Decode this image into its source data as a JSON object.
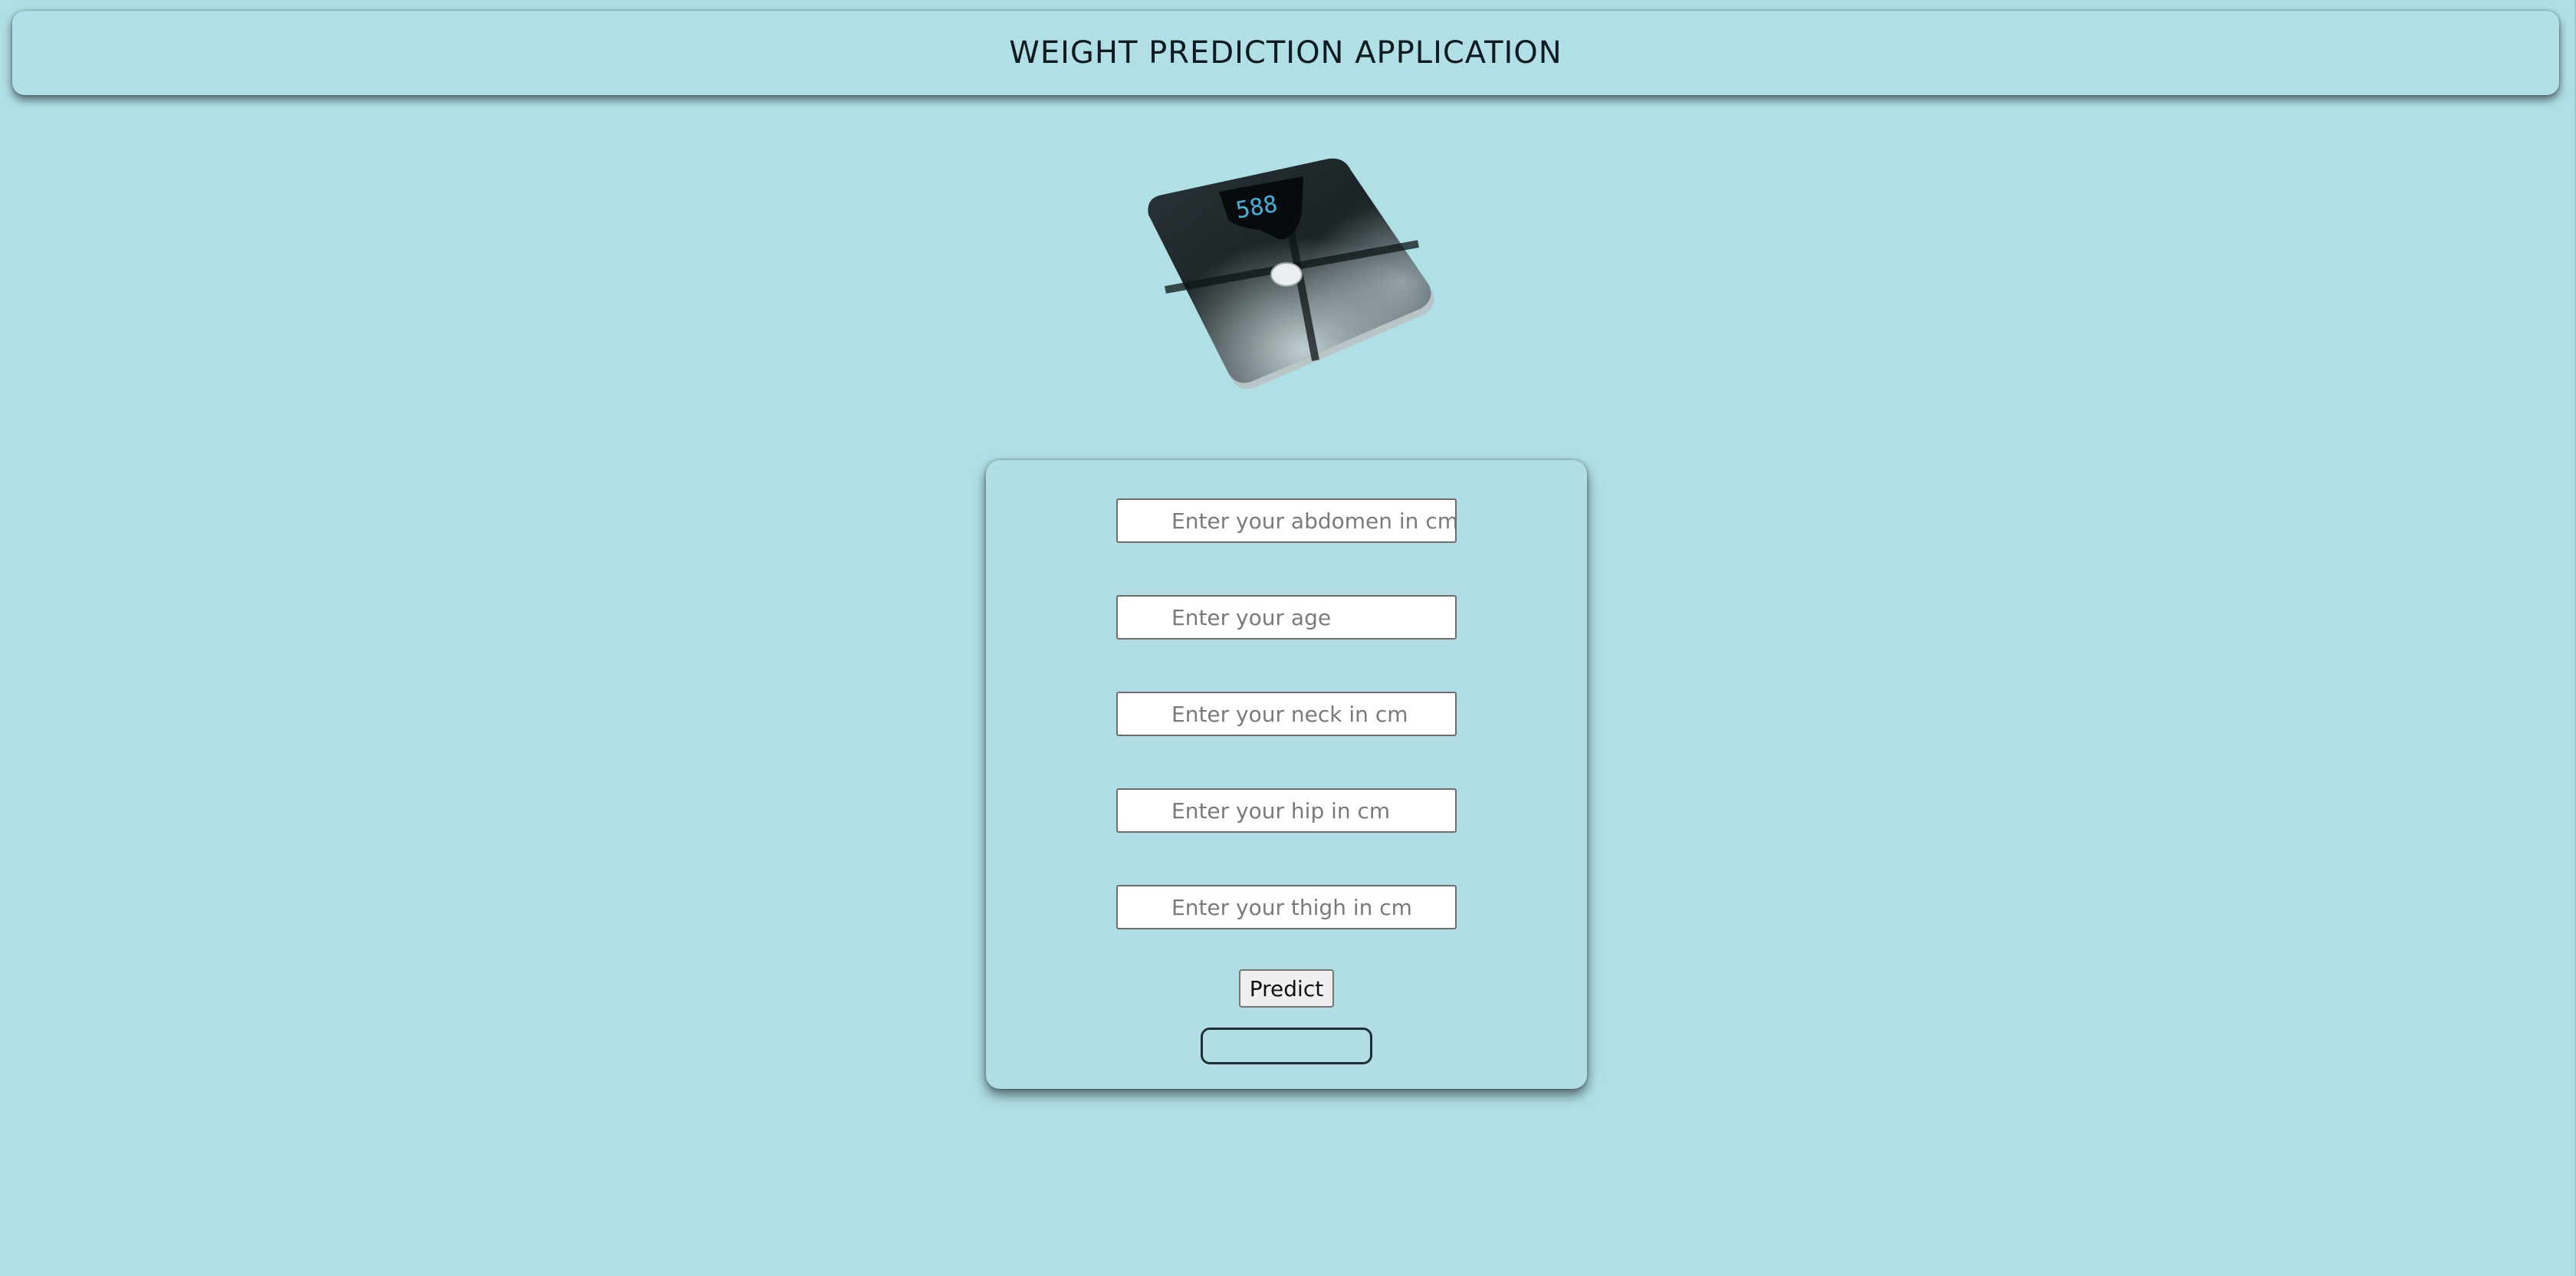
{
  "header": {
    "title": "WEIGHT PREDICTION APPLICATION"
  },
  "illustration": {
    "name": "bathroom-scale-image",
    "display_reading": "588"
  },
  "form": {
    "fields": [
      {
        "name": "abdomen",
        "value": "",
        "placeholder": "Enter your abdomen in cm"
      },
      {
        "name": "age",
        "value": "",
        "placeholder": "Enter your age"
      },
      {
        "name": "neck",
        "value": "",
        "placeholder": "Enter your neck in cm"
      },
      {
        "name": "hip",
        "value": "",
        "placeholder": "Enter your hip in cm"
      },
      {
        "name": "thigh",
        "value": "",
        "placeholder": "Enter your thigh in cm"
      }
    ],
    "predict_label": "Predict",
    "result_text": ""
  },
  "colors": {
    "background": "#b0e0e6",
    "card": "#b0dee4",
    "display_digits": "#3fb6e0"
  }
}
